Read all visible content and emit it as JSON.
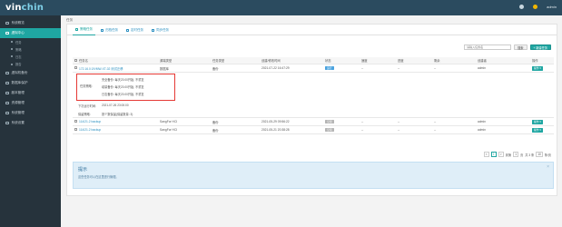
{
  "app": {
    "logo_main": "vin",
    "logo_accent": "chin",
    "user": "admin"
  },
  "sidebar": {
    "items": [
      {
        "label": "系统概览",
        "active": false
      },
      {
        "label": "虚拟中心",
        "active": true
      },
      {
        "label": "虚拟机备份",
        "active": false
      },
      {
        "label": "数据库保护",
        "active": false
      },
      {
        "label": "副本管理",
        "active": false
      },
      {
        "label": "资源管理",
        "active": false
      },
      {
        "label": "系统管理",
        "active": false
      },
      {
        "label": "系统设置",
        "active": false
      }
    ],
    "subitems": [
      "任务",
      "策略",
      "日志",
      "报告"
    ]
  },
  "breadcrumb": "任务",
  "tabs": [
    {
      "label": "策略任务",
      "active": true
    },
    {
      "label": "归档任务",
      "active": false
    },
    {
      "label": "定时任务",
      "active": false
    },
    {
      "label": "同步任务",
      "active": false
    }
  ],
  "search": {
    "placeholder": "请输入任务名",
    "search_button": "搜索",
    "create_button": "+ 新建任务"
  },
  "table": {
    "headers": [
      "任务名",
      "源端类型",
      "任务类型",
      "创建/修改时间",
      "状态",
      "速度",
      "进度",
      "剩余",
      "创建者",
      "操作"
    ],
    "rows": [
      {
        "name": "172.16.0.0/VMW-XT-02 测试迁移",
        "source": "数据库",
        "type": "备份",
        "time": "2021-07-22 16:47:29",
        "status": "运行",
        "speed": "--",
        "progress": "--",
        "remaining": "--",
        "creator": "admin",
        "op": "操作 ▾"
      },
      {
        "name": "114/21.2 backup",
        "source": "SangFor HCI",
        "type": "备份",
        "time": "2021-05-29 09:56:22",
        "status": "空闲",
        "speed": "--",
        "progress": "--",
        "remaining": "--",
        "creator": "admin",
        "op": "操作 ▾"
      },
      {
        "name": "114/21.2 backup",
        "source": "SangFor HCI",
        "type": "备份",
        "time": "2021-05-21 20:38:28",
        "status": "空闲",
        "speed": "--",
        "progress": "--",
        "remaining": "--",
        "creator": "admin",
        "op": "操作 ▾"
      }
    ]
  },
  "detail": {
    "strategy_label": "任务策略:",
    "strategy_lines": [
      "完全备份: 每天23:00开始, 不重复",
      "增量备份: 每天23:00开始, 不重复",
      "日志备份: 每天23:00开始, 不重复"
    ],
    "next_time_label": "下次运行时间:",
    "next_time_value": "2021-07-26 23:00:00",
    "retention_label": "保留策略:",
    "retention_value": "按个数保留(保留数量: 3)"
  },
  "pager": {
    "prev": "<",
    "current": "1",
    "next": ">",
    "jump_label": "到第",
    "page_input": "1",
    "page_unit": "页",
    "total": "共 3 条",
    "per_page": "10",
    "per_unit": "条/页"
  },
  "tips": {
    "title": "提示",
    "text": "这些任务可以在这里进行管理。",
    "close": "×"
  },
  "colors": {
    "accent": "#1fa6a2",
    "topbar": "#2b4b5f",
    "sidebar": "#26333c",
    "highlight_box": "#e53935"
  }
}
